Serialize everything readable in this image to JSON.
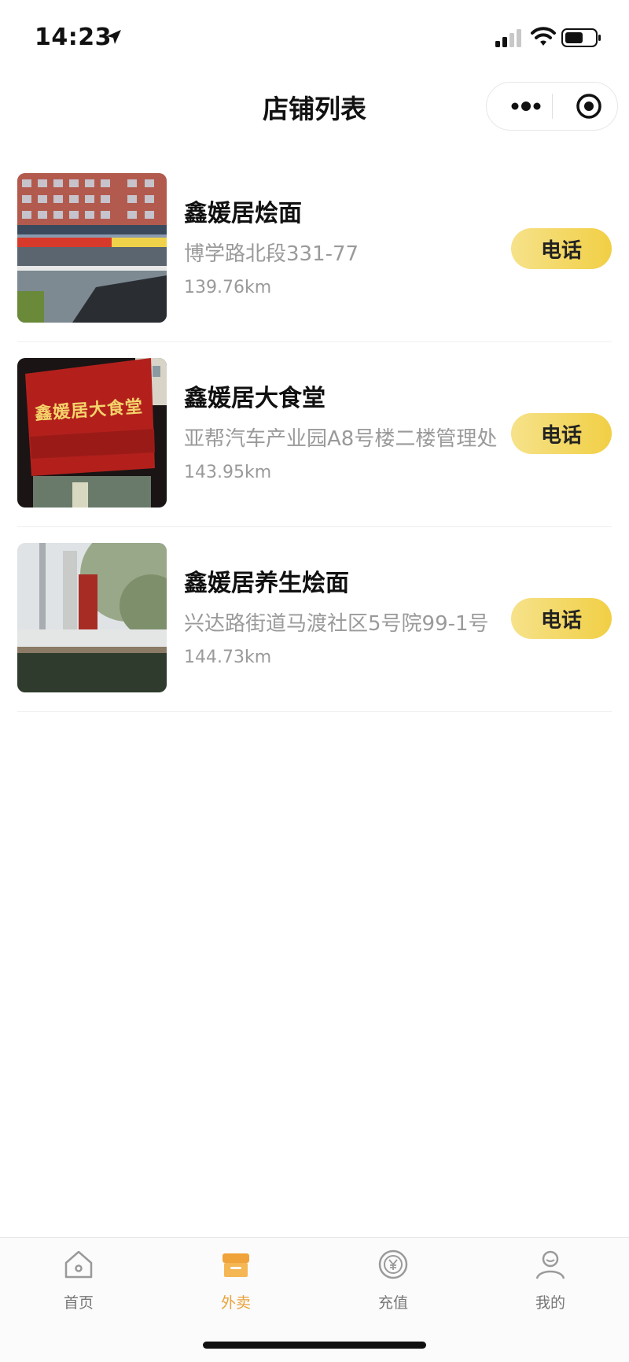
{
  "status_bar": {
    "time": "14:23"
  },
  "nav": {
    "title": "店铺列表"
  },
  "stores": [
    {
      "name": "鑫媛居烩面",
      "address": "博学路北段331-77",
      "distance": "139.76km",
      "call_label": "电话"
    },
    {
      "name": "鑫媛居大食堂",
      "address": "亚帮汽车产业园A8号楼二楼管理处",
      "distance": "143.95km",
      "call_label": "电话",
      "sign_text": "鑫媛居大食堂"
    },
    {
      "name": "鑫媛居养生烩面",
      "address": "兴达路街道马渡社区5号院99-1号",
      "distance": "144.73km",
      "call_label": "电话"
    }
  ],
  "tabs": [
    {
      "label": "首页",
      "icon": "home-icon"
    },
    {
      "label": "外卖",
      "icon": "store-icon"
    },
    {
      "label": "充值",
      "icon": "yuan-coin-icon"
    },
    {
      "label": "我的",
      "icon": "user-icon"
    }
  ],
  "active_tab": "外卖",
  "colors": {
    "accent": "#e9a23b",
    "call_button": "#f1cf45"
  }
}
